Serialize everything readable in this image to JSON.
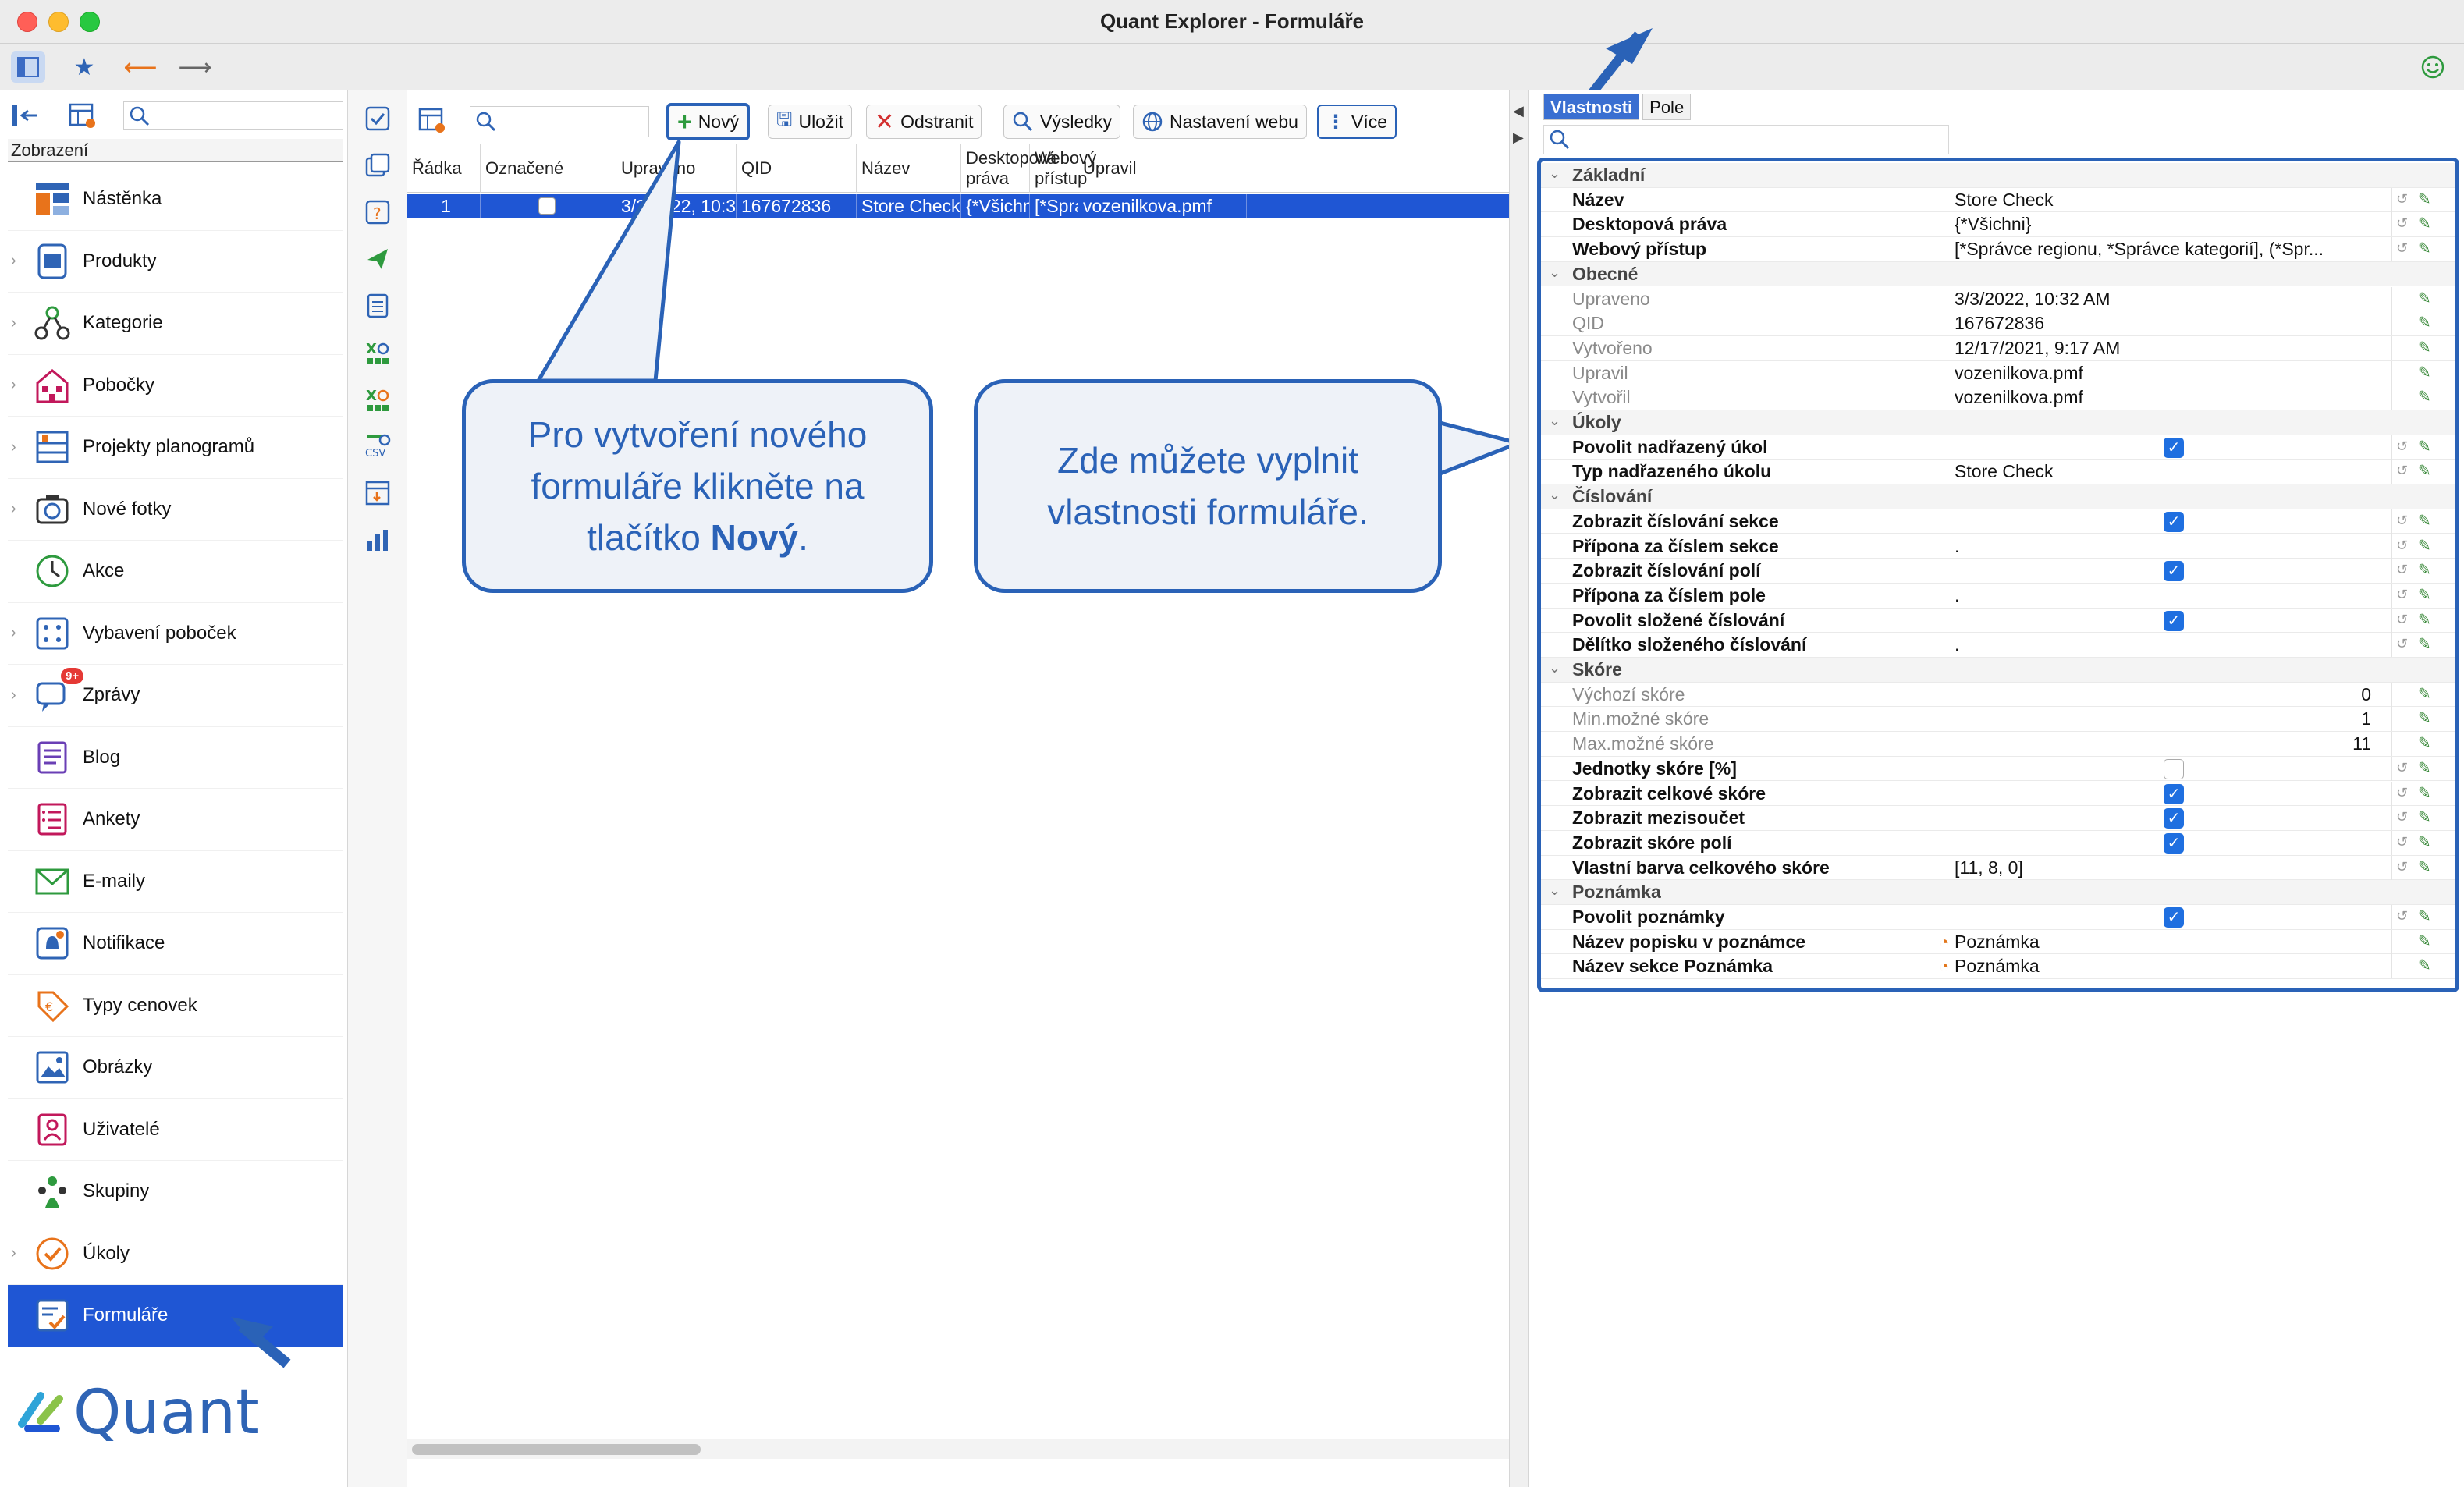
{
  "window": {
    "title": "Quant Explorer - Formuláře"
  },
  "sidebar": {
    "header": "Zobrazení",
    "items": [
      {
        "label": "Nástěnka",
        "icon": "dashboard-icon",
        "expandable": false
      },
      {
        "label": "Produkty",
        "icon": "products-icon",
        "expandable": true
      },
      {
        "label": "Kategorie",
        "icon": "categories-icon",
        "expandable": true
      },
      {
        "label": "Pobočky",
        "icon": "stores-icon",
        "expandable": true
      },
      {
        "label": "Projekty planogramů",
        "icon": "planogram-icon",
        "expandable": true
      },
      {
        "label": "Nové fotky",
        "icon": "camera-icon",
        "expandable": true
      },
      {
        "label": "Akce",
        "icon": "clock-icon",
        "expandable": false
      },
      {
        "label": "Vybavení poboček",
        "icon": "equipment-icon",
        "expandable": true
      },
      {
        "label": "Zprávy",
        "icon": "messages-icon",
        "expandable": true,
        "badge": "9+"
      },
      {
        "label": "Blog",
        "icon": "blog-icon",
        "expandable": false
      },
      {
        "label": "Ankety",
        "icon": "survey-icon",
        "expandable": false
      },
      {
        "label": "E-maily",
        "icon": "mail-icon",
        "expandable": false
      },
      {
        "label": "Notifikace",
        "icon": "bell-icon",
        "expandable": false
      },
      {
        "label": "Typy cenovek",
        "icon": "price-tag-icon",
        "expandable": false
      },
      {
        "label": "Obrázky",
        "icon": "image-icon",
        "expandable": false
      },
      {
        "label": "Uživatelé",
        "icon": "user-icon",
        "expandable": false
      },
      {
        "label": "Skupiny",
        "icon": "group-icon",
        "expandable": false
      },
      {
        "label": "Úkoly",
        "icon": "task-icon",
        "expandable": true
      },
      {
        "label": "Formuláře",
        "icon": "form-icon",
        "expandable": false,
        "active": true
      }
    ],
    "logo_text": "Quant"
  },
  "toolbar": {
    "new_label": "Nový",
    "save_label": "Uložit",
    "delete_label": "Odstranit",
    "results_label": "Výsledky",
    "web_settings_label": "Nastavení webu",
    "more_label": "Více"
  },
  "grid": {
    "columns": [
      "Řádka",
      "Označené",
      "Upraveno",
      "QID",
      "Název",
      "Desktopová práva",
      "Webový přístup",
      "Upravil"
    ],
    "rows": [
      {
        "row": "1",
        "checked": false,
        "modified": "3/3/2022, 10:32 ...",
        "qid": "167672836",
        "name": "Store Check",
        "desktop": "{*Všichni}",
        "web": "[*Správ...",
        "modified_by": "vozenilkova.pmf"
      }
    ]
  },
  "callouts": {
    "left": {
      "text_before": "Pro vytvoření nového formuláře klikněte na tlačítko ",
      "bold": "Nový",
      "text_after": "."
    },
    "right": {
      "text": "Zde můžete vyplnit vlastnosti formuláře."
    }
  },
  "props": {
    "tabs": [
      "Vlastnosti",
      "Pole"
    ],
    "rows": [
      {
        "type": "group",
        "label": "Základní"
      },
      {
        "type": "text",
        "label": "Název",
        "value": "Store Check"
      },
      {
        "type": "text",
        "label": "Desktopová práva",
        "value": "{*Všichni}"
      },
      {
        "type": "text",
        "label": "Webový přístup",
        "value": "[*Správce regionu, *Správce kategorií], (*Spr..."
      },
      {
        "type": "group",
        "label": "Obecné"
      },
      {
        "type": "text",
        "label": "Upraveno",
        "value": "3/3/2022, 10:32 AM",
        "dim": true
      },
      {
        "type": "text",
        "label": "QID",
        "value": "167672836",
        "dim": true
      },
      {
        "type": "text",
        "label": "Vytvořeno",
        "value": "12/17/2021, 9:17 AM",
        "dim": true
      },
      {
        "type": "text",
        "label": "Upravil",
        "value": "vozenilkova.pmf",
        "dim": true
      },
      {
        "type": "text",
        "label": "Vytvořil",
        "value": "vozenilkova.pmf",
        "dim": true
      },
      {
        "type": "group",
        "label": "Úkoly"
      },
      {
        "type": "check",
        "label": "Povolit nadřazený úkol",
        "checked": true
      },
      {
        "type": "text",
        "label": "Typ nadřazeného úkolu",
        "value": "Store Check"
      },
      {
        "type": "group",
        "label": "Číslování"
      },
      {
        "type": "check",
        "label": "Zobrazit číslování sekce",
        "checked": true
      },
      {
        "type": "text",
        "label": "Přípona za číslem sekce",
        "value": "."
      },
      {
        "type": "check",
        "label": "Zobrazit číslování polí",
        "checked": true
      },
      {
        "type": "text",
        "label": "Přípona za číslem pole",
        "value": "."
      },
      {
        "type": "check",
        "label": "Povolit složené číslování",
        "checked": true
      },
      {
        "type": "text",
        "label": "Dělítko složeného číslování",
        "value": "."
      },
      {
        "type": "group",
        "label": "Skóre"
      },
      {
        "type": "num",
        "label": "Výchozí skóre",
        "value": "0",
        "dim": true
      },
      {
        "type": "num",
        "label": "Min.možné skóre",
        "value": "1",
        "dim": true
      },
      {
        "type": "num",
        "label": "Max.možné skóre",
        "value": "11",
        "dim": true
      },
      {
        "type": "check",
        "label": "Jednotky skóre [%]",
        "checked": false
      },
      {
        "type": "check",
        "label": "Zobrazit celkové skóre",
        "checked": true
      },
      {
        "type": "check",
        "label": "Zobrazit mezisoučet",
        "checked": true
      },
      {
        "type": "check",
        "label": "Zobrazit skóre polí",
        "checked": true
      },
      {
        "type": "text",
        "label": "Vlastní barva celkového skóre",
        "value": "[11, 8, 0]"
      },
      {
        "type": "group",
        "label": "Poznámka"
      },
      {
        "type": "check",
        "label": "Povolit poznámky",
        "checked": true
      },
      {
        "type": "tpl",
        "label": "Název popisku v poznámce",
        "value": "Poznámka"
      },
      {
        "type": "tpl",
        "label": "Název sekce Poznámka",
        "value": "Poznámka"
      }
    ]
  },
  "colors": {
    "accent": "#1f56d4",
    "callout": "#2a62b7"
  }
}
